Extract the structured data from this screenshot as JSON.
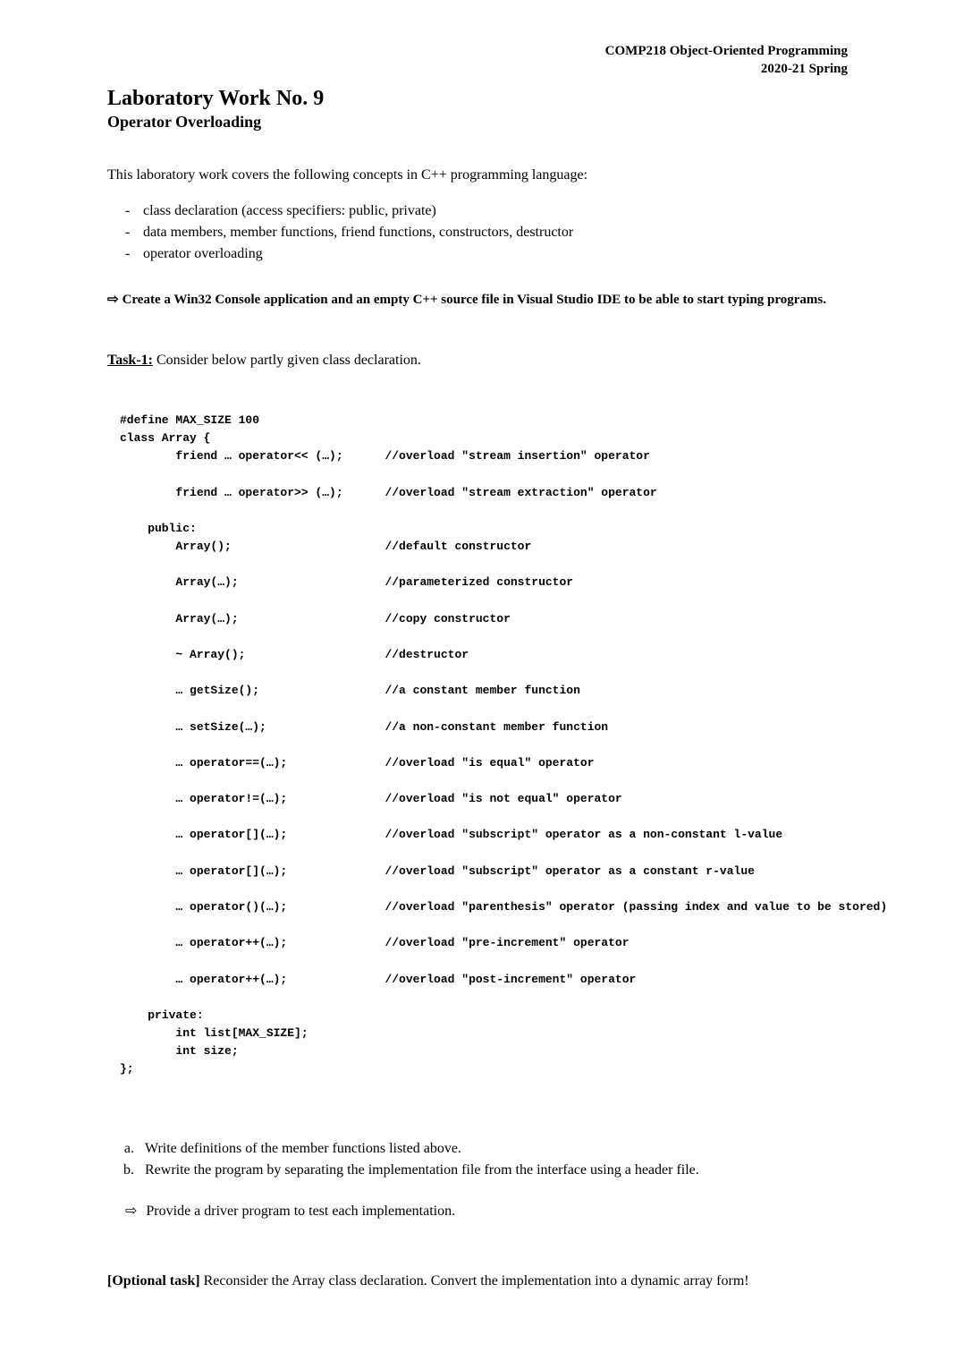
{
  "header": {
    "course": "COMP218 Object-Oriented Programming",
    "term": "2020-21 Spring"
  },
  "title": "Laboratory Work No. 9",
  "subtitle": "Operator Overloading",
  "intro": "This laboratory work covers the following concepts in C++ programming language:",
  "concepts": [
    "class declaration (access specifiers: public, private)",
    "data members, member functions, friend functions, constructors, destructor",
    "operator overloading"
  ],
  "instruction_arrow": "⇨",
  "instruction": "Create a Win32 Console application and an empty C++ source file in Visual Studio IDE to be able to start typing programs.",
  "task": {
    "label": "Task-1:",
    "text": " Consider below partly given class declaration."
  },
  "code": {
    "l1": "#define MAX_SIZE 100",
    "l2": "class Array {",
    "f1d": "        friend … operator<< (…);      ",
    "f1c": "//overload \"stream insertion\" operator",
    "f2d": "        friend … operator>> (…);      ",
    "f2c": "//overload \"stream extraction\" operator",
    "pub": "    public:",
    "p1d": "        Array();                      ",
    "p1c": "//default constructor",
    "p2d": "        Array(…);                     ",
    "p2c": "//parameterized constructor",
    "p3d": "        Array(…);                     ",
    "p3c": "//copy constructor",
    "p4d": "        ~ Array();                    ",
    "p4c": "//destructor",
    "p5d": "        … getSize();                  ",
    "p5c": "//a constant member function",
    "p6d": "        … setSize(…);                 ",
    "p6c": "//a non-constant member function",
    "p7d": "        … operator==(…);              ",
    "p7c": "//overload \"is equal\" operator",
    "p8d": "        … operator!=(…);              ",
    "p8c": "//overload \"is not equal\" operator",
    "p9d": "        … operator[](…);              ",
    "p9c": "//overload \"subscript\" operator as a non-constant l-value",
    "p10d": "        … operator[](…);              ",
    "p10c": "//overload \"subscript\" operator as a constant r-value",
    "p11d": "        … operator()(…);              ",
    "p11c": "//overload \"parenthesis\" operator (passing index and value to be stored)",
    "p12d": "        … operator++(…);              ",
    "p12c": "//overload \"pre-increment\" operator",
    "p13d": "        … operator++(…);              ",
    "p13c": "//overload \"post-increment\" operator",
    "priv": "    private:",
    "pv1": "        int list[MAX_SIZE];",
    "pv2": "        int size;",
    "end": "};"
  },
  "subtasks": [
    "Write definitions of the member functions listed above.",
    "Rewrite the program by separating the implementation file from the interface using a header file."
  ],
  "driver_arrow": "⇨",
  "driver_note": "Provide a driver program to test each implementation.",
  "optional": {
    "label": "[Optional task]",
    "text": " Reconsider the Array class declaration. Convert the implementation into a dynamic array form!"
  }
}
